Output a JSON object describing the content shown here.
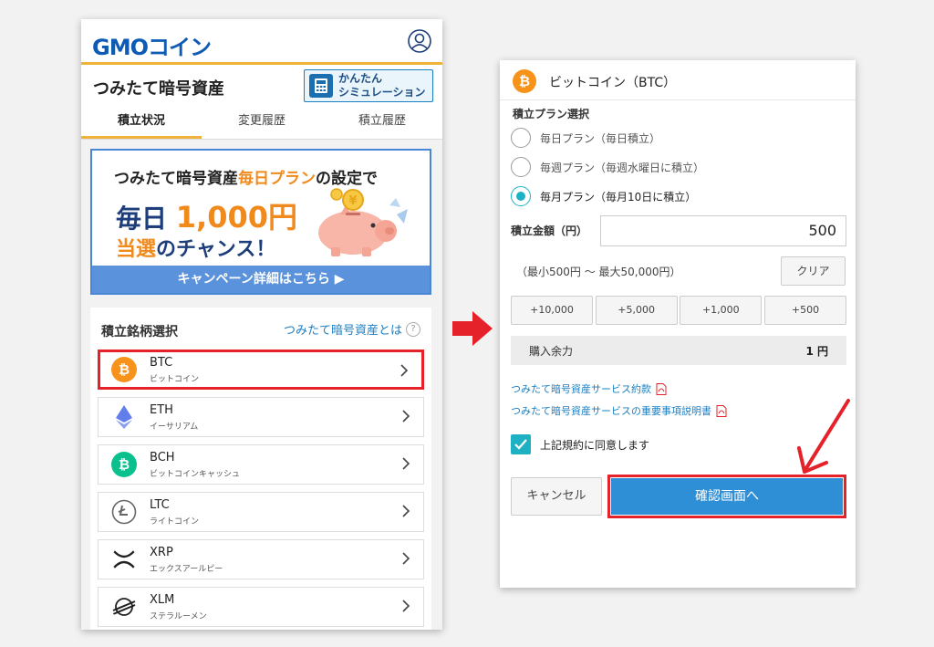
{
  "left": {
    "logo": {
      "gmo": "GMO",
      "coin": "コイン"
    },
    "title": "つみたて暗号資産",
    "simulation_button": {
      "line1": "かんたん",
      "line2": "シミュレーション"
    },
    "tabs": [
      {
        "label": "積立状況",
        "active": true
      },
      {
        "label": "変更履歴",
        "active": false
      },
      {
        "label": "積立履歴",
        "active": false
      }
    ],
    "banner": {
      "line1_pre": "つみたて暗号資産",
      "line1_hl": "毎日プラン",
      "line1_post": "の設定で",
      "line2_pre": "毎日",
      "line2_amount": "1,000円",
      "line3_hl": "当選",
      "line3_post": "のチャンス！",
      "footer": "キャンペーン詳細はこちら ▶"
    },
    "coin_section": {
      "title": "積立銘柄選択",
      "help_link": "つみたて暗号資産とは",
      "coins": [
        {
          "symbol": "BTC",
          "name": "ビットコイン",
          "color": "#f7931a",
          "selected": true
        },
        {
          "symbol": "ETH",
          "name": "イーサリアム",
          "color": "#627eea",
          "selected": false
        },
        {
          "symbol": "BCH",
          "name": "ビットコインキャッシュ",
          "color": "#0ac18e",
          "selected": false
        },
        {
          "symbol": "LTC",
          "name": "ライトコイン",
          "color": "#888888",
          "selected": false
        },
        {
          "symbol": "XRP",
          "name": "エックスアールピー",
          "color": "#222222",
          "selected": false
        },
        {
          "symbol": "XLM",
          "name": "ステラルーメン",
          "color": "#222222",
          "selected": false
        }
      ]
    }
  },
  "right": {
    "title": "ビットコイン（BTC）",
    "plan_label": "積立プラン選択",
    "plans": [
      {
        "label": "毎日プラン（毎日積立）",
        "selected": false
      },
      {
        "label": "毎週プラン（毎週水曜日に積立）",
        "selected": false
      },
      {
        "label": "毎月プラン（毎月10日に積立）",
        "selected": true
      }
    ],
    "amount_label": "積立金額（円）",
    "amount_value": "500",
    "range_text": "（最小500円 〜 最大50,000円）",
    "clear_label": "クリア",
    "increments": [
      "+10,000",
      "+5,000",
      "+1,000",
      "+500"
    ],
    "available_label": "購入余力",
    "available_value": "1 円",
    "doc_links": [
      "つみたて暗号資産サービス約款",
      "つみたて暗号資産サービスの重要事項説明書"
    ],
    "agree_label": "上記規約に同意します",
    "cancel_label": "キャンセル",
    "confirm_label": "確認画面へ"
  },
  "colors": {
    "accent_orange": "#f0b23a",
    "highlight_red": "#e5222a",
    "primary_blue": "#2f8fd6",
    "teal": "#1eb1c4"
  }
}
